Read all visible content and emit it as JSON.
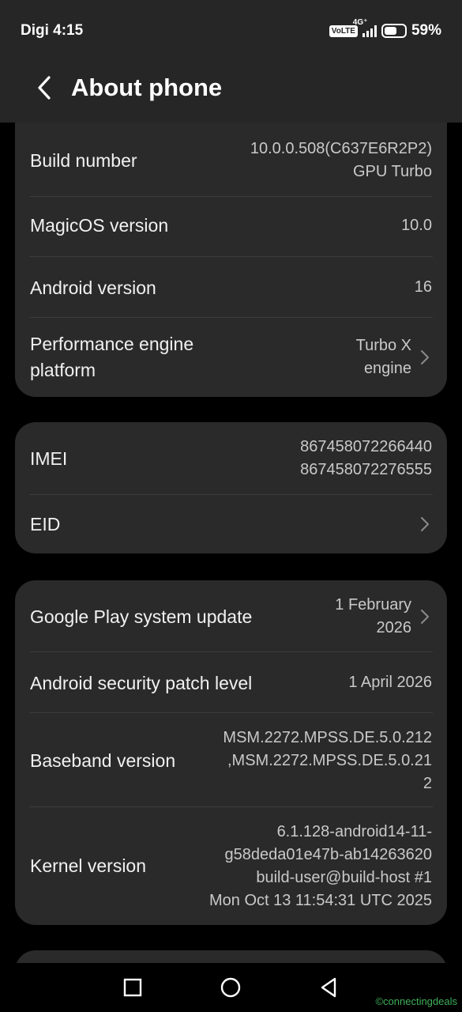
{
  "status_bar": {
    "carrier_time": "Digi 4:15",
    "volte": "VoLTE",
    "network": "4G⁺",
    "battery_percent": "59%",
    "battery_level": 0.59
  },
  "header": {
    "title": "About phone"
  },
  "group1": {
    "build_number_label": "Build number",
    "build_number_value_line1": "10.0.0.508(C637E6R2P2)",
    "build_number_value_line2": "GPU Turbo",
    "magicos_label": "MagicOS version",
    "magicos_value": "10.0",
    "android_label": "Android version",
    "android_value": "16",
    "perf_label_line1": "Performance engine",
    "perf_label_line2": "platform",
    "perf_value_line1": "Turbo X",
    "perf_value_line2": "engine"
  },
  "group2": {
    "imei_label": "IMEI",
    "imei_value_line1": "867458072266440",
    "imei_value_line2": "867458072276555",
    "eid_label": "EID"
  },
  "group3": {
    "gplay_label": "Google Play system update",
    "gplay_value_line1": "1 February",
    "gplay_value_line2": "2026",
    "patch_label": "Android security patch level",
    "patch_value": "1 April 2026",
    "baseband_label": "Baseband version",
    "baseband_value_line1": "MSM.2272.MPSS.DE.5.0.212",
    "baseband_value_line2": ",MSM.2272.MPSS.DE.5.0.21",
    "baseband_value_line3": "2",
    "kernel_label": "Kernel version",
    "kernel_value_line1": "6.1.128-android14-11-",
    "kernel_value_line2": "g58deda01e47b-ab14263620",
    "kernel_value_line3": "build-user@build-host #1",
    "kernel_value_line4": "Mon Oct 13 11:54:31 UTC 2025"
  },
  "watermark": "©connectingdeals",
  "colors": {
    "background": "#000000",
    "card": "#2a2a2a",
    "header": "#262626",
    "text_primary": "#f1f1f1",
    "text_secondary": "#c9c9c9",
    "watermark": "#3fb05a"
  }
}
